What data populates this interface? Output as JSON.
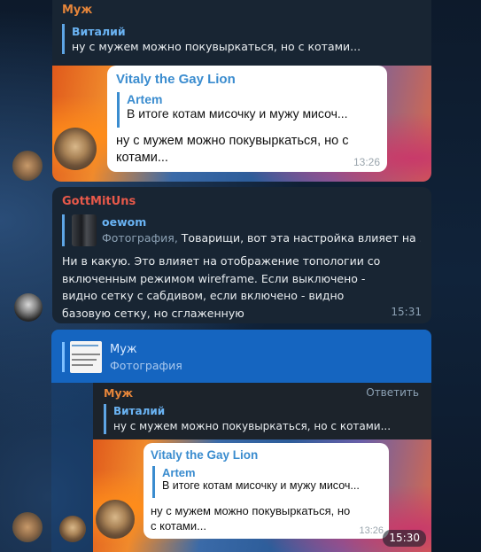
{
  "messages": [
    {
      "author": "Муж",
      "reply_name": "Виталий",
      "reply_text": "ну с мужем можно покувыркаться, но с котами...",
      "inner": {
        "author": "Vitaly the Gay Lion",
        "quote_name": "Artem",
        "quote_text": "В итоге котам мисочку и мужу мисоч...",
        "text": "ну с мужем можно покувыркаться, но с котами...",
        "time": "13:26"
      }
    },
    {
      "author": "GottMitUns",
      "reply_name": "oewom",
      "reply_kind": "Фотография,",
      "reply_text": "Товарищи, вот эта настройка влияет на ...",
      "text": "Ни в какую. Это влияет на отображение топологии со включенным режимом wireframe. Если выключено - видно сетку с сабдивом, если включено - видно базовую сетку, но сглаженную",
      "time": "15:31"
    },
    {
      "reply_banner_name": "Муж",
      "reply_banner_kind": "Фотография",
      "author": "Муж",
      "action": "Ответить",
      "reply_name": "Виталий",
      "reply_text": "ну с мужем можно покувыркаться, но с котами...",
      "inner": {
        "author": "Vitaly the Gay Lion",
        "quote_name": "Artem",
        "quote_text": "В итоге котам мисочку и мужу мисоч...",
        "text": "ну с мужем можно покувыркаться, но с котами...",
        "time": "13:26"
      },
      "time": "15:30"
    }
  ],
  "colors": {
    "author_muzh": "#e5853a",
    "author_gott": "#e8594a",
    "link_blue": "#6ab3f3",
    "selection_blue": "#1565c0"
  }
}
